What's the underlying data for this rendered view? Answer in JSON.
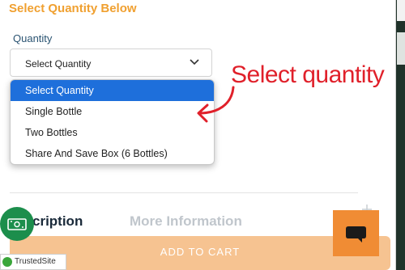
{
  "section": {
    "heading": "Select Quantity Below"
  },
  "quantity": {
    "label": "Quantity",
    "selected": "Select Quantity",
    "options": [
      "Select Quantity",
      "Single Bottle",
      "Two Bottles",
      "Share And Save Box (6 Bottles)"
    ]
  },
  "annotation": {
    "text": "Select quantity",
    "color": "#e0202a"
  },
  "tabs": {
    "description": "cription",
    "more_info": "More Information"
  },
  "cart": {
    "add_label": "ADD TO CART"
  },
  "trust": {
    "label": "TrustedSite"
  },
  "icons": {
    "chevron": "chevron-down-icon",
    "money": "money-icon",
    "chat": "chat-icon",
    "plus": "plus-icon",
    "arrow": "curved-arrow-icon"
  },
  "colors": {
    "heading": "#f0a030",
    "selected_option": "#1e6fdb",
    "add_to_cart": "#f6c391",
    "chat_button": "#f08c34",
    "money_badge": "#1c8e4c"
  }
}
